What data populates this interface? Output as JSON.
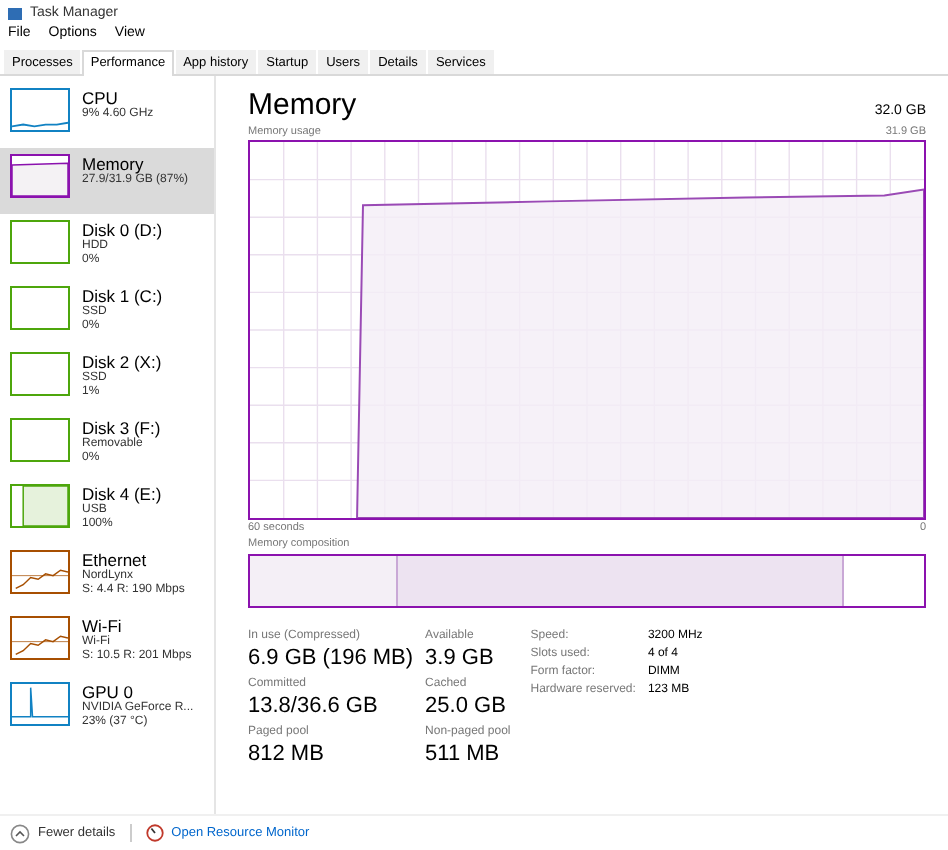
{
  "window": {
    "title": "Task Manager"
  },
  "menu": [
    "File",
    "Options",
    "View"
  ],
  "tabs": [
    {
      "label": "Processes",
      "selected": false
    },
    {
      "label": "Performance",
      "selected": true
    },
    {
      "label": "App history",
      "selected": false
    },
    {
      "label": "Startup",
      "selected": false
    },
    {
      "label": "Users",
      "selected": false
    },
    {
      "label": "Details",
      "selected": false
    },
    {
      "label": "Services",
      "selected": false
    }
  ],
  "sidebar": {
    "items": [
      {
        "kind": "cpu",
        "name": "CPU",
        "lines": [
          "9% 4.60 GHz"
        ],
        "selected": false
      },
      {
        "kind": "memory",
        "name": "Memory",
        "lines": [
          "27.9/31.9 GB (87%)"
        ],
        "selected": true
      },
      {
        "kind": "disk",
        "name": "Disk 0 (D:)",
        "lines": [
          "HDD",
          "0%"
        ],
        "selected": false
      },
      {
        "kind": "disk",
        "name": "Disk 1 (C:)",
        "lines": [
          "SSD",
          "0%"
        ],
        "selected": false
      },
      {
        "kind": "disk",
        "name": "Disk 2 (X:)",
        "lines": [
          "SSD",
          "1%"
        ],
        "selected": false
      },
      {
        "kind": "disk",
        "name": "Disk 3 (F:)",
        "lines": [
          "Removable",
          "0%"
        ],
        "selected": false
      },
      {
        "kind": "busydisk",
        "name": "Disk 4 (E:)",
        "lines": [
          "USB",
          "100%"
        ],
        "selected": false
      },
      {
        "kind": "network",
        "name": "Ethernet",
        "lines": [
          "NordLynx",
          "S: 4.4  R: 190 Mbps"
        ],
        "selected": false
      },
      {
        "kind": "network",
        "name": "Wi-Fi",
        "lines": [
          "Wi-Fi",
          "S: 10.5  R: 201 Mbps"
        ],
        "selected": false
      },
      {
        "kind": "gpu",
        "name": "GPU 0",
        "lines": [
          "NVIDIA GeForce R...",
          "23% (37 °C)"
        ],
        "selected": false
      }
    ]
  },
  "panel": {
    "title": "Memory",
    "total": "32.0 GB",
    "usage_label": "Memory usage",
    "usage_max": "31.9 GB",
    "time_start": "60 seconds",
    "time_end": "0",
    "composition_label": "Memory composition",
    "stats": [
      {
        "label": "In use (Compressed)",
        "value": "6.9 GB (196 MB)"
      },
      {
        "label": "Available",
        "value": "3.9 GB"
      },
      {
        "label": "Committed",
        "value": "13.8/36.6 GB"
      },
      {
        "label": "Cached",
        "value": "25.0 GB"
      },
      {
        "label": "Paged pool",
        "value": "812 MB"
      },
      {
        "label": "Non-paged pool",
        "value": "511 MB"
      }
    ],
    "details": [
      {
        "label": "Speed:",
        "value": "3200 MHz"
      },
      {
        "label": "Slots used:",
        "value": "4 of 4"
      },
      {
        "label": "Form factor:",
        "value": "DIMM"
      },
      {
        "label": "Hardware reserved:",
        "value": "123 MB"
      }
    ]
  },
  "footer": {
    "fewer_details": "Fewer details",
    "resource_monitor": "Open Resource Monitor"
  }
}
